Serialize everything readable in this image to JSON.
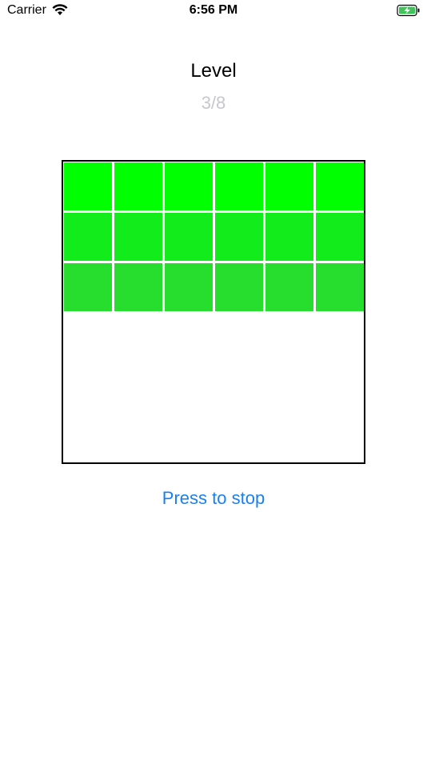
{
  "status_bar": {
    "carrier": "Carrier",
    "time": "6:56 PM",
    "wifi_icon": "wifi-icon",
    "battery_icon": "battery-charging-icon",
    "battery_color": "#3fc35a"
  },
  "header": {
    "title": "Level",
    "progress": "3/8"
  },
  "board": {
    "rows_filled": 3,
    "columns": 6,
    "row_colors": [
      "#00ff00",
      "#12ec1a",
      "#27dd2e"
    ]
  },
  "action": {
    "stop_label": "Press to stop",
    "color": "#1a7ff0"
  }
}
